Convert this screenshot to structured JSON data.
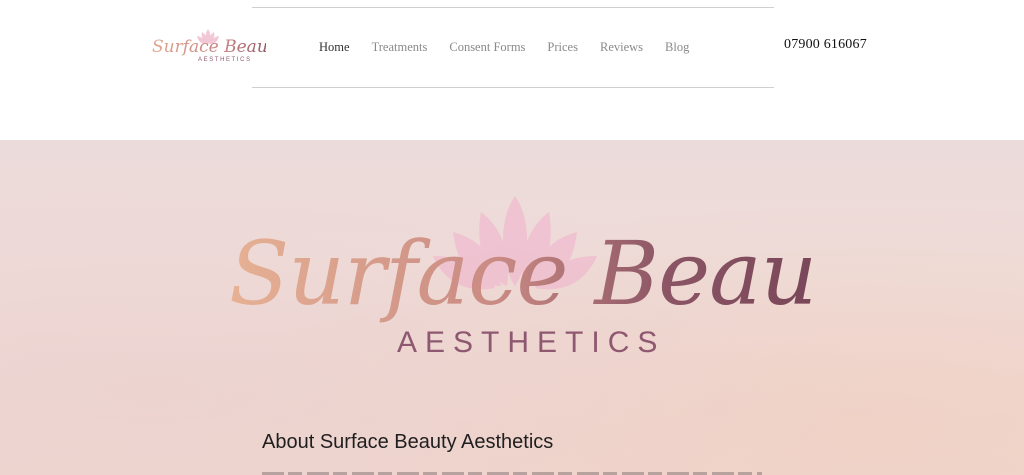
{
  "brand": {
    "name_script": "Surface Beauty",
    "name_sub": "AESTHETICS",
    "colors": {
      "script_light": "#e2a88f",
      "script_dark": "#7d4a5c",
      "subtitle": "#8e5870",
      "lotus": "#f2c3d2"
    }
  },
  "nav": {
    "items": [
      {
        "label": "Home",
        "active": true
      },
      {
        "label": "Treatments",
        "active": false
      },
      {
        "label": "Consent Forms",
        "active": false
      },
      {
        "label": "Prices",
        "active": false
      },
      {
        "label": "Reviews",
        "active": false
      },
      {
        "label": "Blog",
        "active": false
      }
    ]
  },
  "header": {
    "phone": "07900 616067"
  },
  "hero": {
    "logo_script": "Surface Beauty",
    "logo_sub": "AESTHETICS",
    "icon": "lotus-icon"
  },
  "about": {
    "heading": "About Surface Beauty Aesthetics"
  }
}
